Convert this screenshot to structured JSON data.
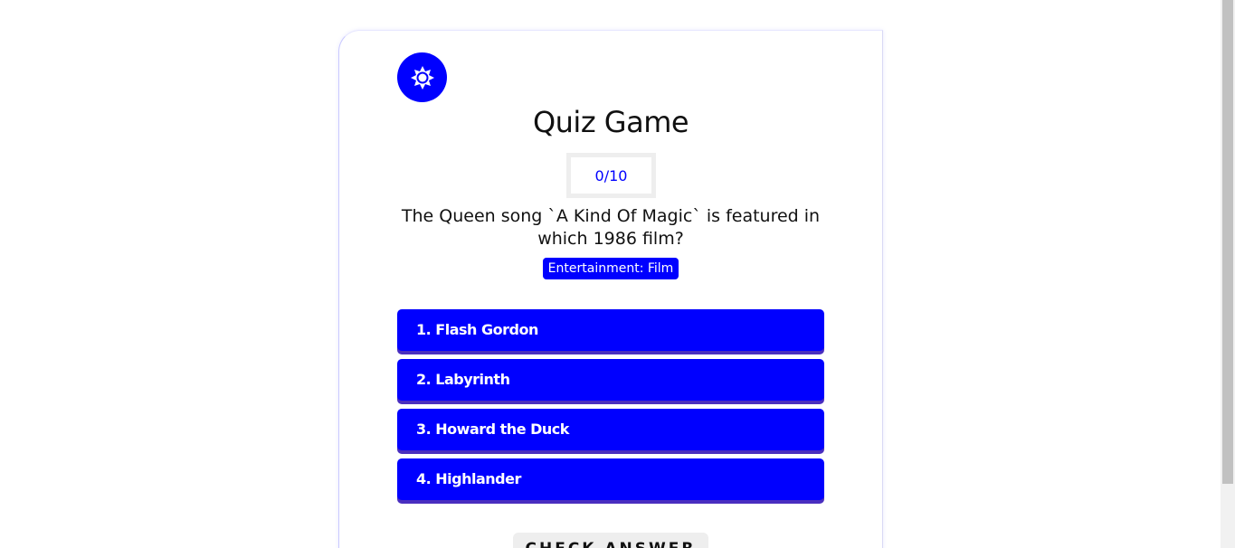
{
  "app": {
    "title": "Quiz Game",
    "theme_icon": "sun-gear-icon",
    "accent_color": "#0000ff"
  },
  "score": {
    "text": "0/10"
  },
  "question": {
    "text": "The Queen song `A Kind Of Magic` is featured in which 1986 film?",
    "category": "Entertainment: Film"
  },
  "options": [
    {
      "label": "1. Flash Gordon"
    },
    {
      "label": "2. Labyrinth"
    },
    {
      "label": "3. Howard the Duck"
    },
    {
      "label": "4. Highlander"
    }
  ],
  "actions": {
    "check_label": "CHECK ANSWER"
  }
}
